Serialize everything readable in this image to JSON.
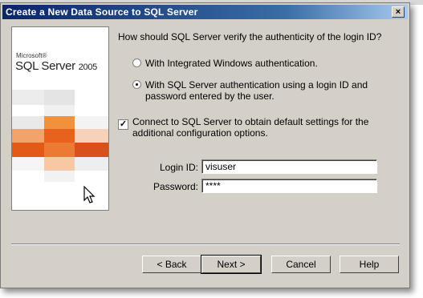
{
  "window": {
    "title": "Create a New Data Source to SQL Server",
    "close_glyph": "×"
  },
  "banner": {
    "brand_small": "Microsoft®",
    "product": "SQL Server",
    "year": "2005"
  },
  "form": {
    "question": "How should SQL Server verify the authenticity of the login ID?",
    "auth_options": [
      {
        "label": "With Integrated Windows authentication.",
        "selected": false
      },
      {
        "label": "With SQL Server authentication using a login ID and password entered by the user.",
        "selected": true
      }
    ],
    "connect_checkbox": {
      "label": "Connect to SQL Server to obtain default settings for the additional configuration options.",
      "checked": true
    },
    "login_id": {
      "label": "Login ID:",
      "value": "visuser"
    },
    "password": {
      "label": "Password:",
      "value": "****"
    }
  },
  "buttons": {
    "back": "< Back",
    "next": "Next >",
    "cancel": "Cancel",
    "help": "Help"
  },
  "colors": {
    "title_start": "#0a246a",
    "title_end": "#a6caf0",
    "dialog_face": "#d4d0c8",
    "orange": "#e85c1c"
  },
  "icons": [
    "close-icon",
    "mouse-cursor-icon"
  ]
}
